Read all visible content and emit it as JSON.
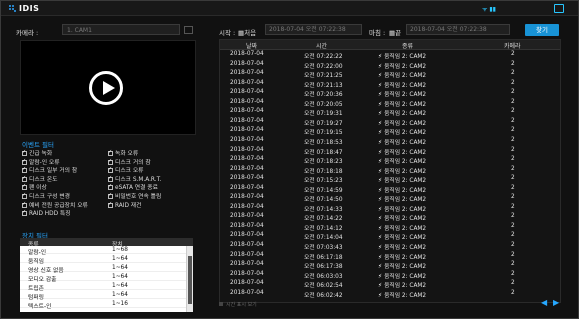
{
  "app": {
    "logo_text": "IDIS"
  },
  "camera": {
    "label": "카메라 :",
    "value": "1. CAM1"
  },
  "events": {
    "title": "이벤트 필터",
    "items": [
      "긴급 녹화",
      "녹화 오류",
      "알람-인 오류",
      "디스크 거의 참",
      "디스크 일부 거의 참",
      "디스크 오류",
      "디스크 온도",
      "디스크 S.M.A.R.T.",
      "팬 이상",
      "eSATA 연결 종료",
      "디스크 구성 변경",
      "비밀번호 연속 틀림",
      "예비 전원 공급장치 오류",
      "RAID 재건",
      "RAID HDD 특징"
    ]
  },
  "devices": {
    "title": "장치 필터",
    "columns": [
      "종류",
      "장치"
    ],
    "rows": [
      [
        "알람-인",
        "1~68"
      ],
      [
        "움직임",
        "1~64"
      ],
      [
        "영상 신호 없음",
        "1~64"
      ],
      [
        "모디오 감출",
        "1~64"
      ],
      [
        "트립존",
        "1~64"
      ],
      [
        "텀퍼링",
        "1~64"
      ],
      [
        "텍스트-인",
        "1~16"
      ]
    ]
  },
  "filter": {
    "start_label": "시작 :",
    "start_mode": "처음",
    "start_value": "2018-07-04 오전 07:22:38",
    "end_label": "마침 :",
    "end_mode": "끝",
    "end_value": "2018-07-04 오전 07:22:38",
    "search_label": "찾기"
  },
  "log": {
    "columns": [
      "날짜",
      "시간",
      "종류",
      "카메라"
    ],
    "rows": [
      [
        "2018-07-04",
        "오전 07:22:22",
        "움직임 2: CAM2",
        "2"
      ],
      [
        "2018-07-04",
        "오전 07:22:00",
        "움직임 2: CAM2",
        "2"
      ],
      [
        "2018-07-04",
        "오전 07:21:25",
        "움직임 2: CAM2",
        "2"
      ],
      [
        "2018-07-04",
        "오전 07:21:13",
        "움직임 2: CAM2",
        "2"
      ],
      [
        "2018-07-04",
        "오전 07:20:36",
        "움직임 2: CAM2",
        "2"
      ],
      [
        "2018-07-04",
        "오전 07:20:05",
        "움직임 2: CAM2",
        "2"
      ],
      [
        "2018-07-04",
        "오전 07:19:31",
        "움직임 2: CAM2",
        "2"
      ],
      [
        "2018-07-04",
        "오전 07:19:27",
        "움직임 2: CAM2",
        "2"
      ],
      [
        "2018-07-04",
        "오전 07:19:15",
        "움직임 2: CAM2",
        "2"
      ],
      [
        "2018-07-04",
        "오전 07:18:53",
        "움직임 2: CAM2",
        "2"
      ],
      [
        "2018-07-04",
        "오전 07:18:47",
        "움직임 2: CAM2",
        "2"
      ],
      [
        "2018-07-04",
        "오전 07:18:23",
        "움직임 2: CAM2",
        "2"
      ],
      [
        "2018-07-04",
        "오전 07:18:18",
        "움직임 2: CAM2",
        "2"
      ],
      [
        "2018-07-04",
        "오전 07:15:23",
        "움직임 2: CAM2",
        "2"
      ],
      [
        "2018-07-04",
        "오전 07:14:59",
        "움직임 2: CAM2",
        "2"
      ],
      [
        "2018-07-04",
        "오전 07:14:50",
        "움직임 2: CAM2",
        "2"
      ],
      [
        "2018-07-04",
        "오전 07:14:33",
        "움직임 2: CAM2",
        "2"
      ],
      [
        "2018-07-04",
        "오전 07:14:22",
        "움직임 2: CAM2",
        "2"
      ],
      [
        "2018-07-04",
        "오전 07:14:12",
        "움직임 2: CAM2",
        "2"
      ],
      [
        "2018-07-04",
        "오전 07:14:04",
        "움직임 2: CAM2",
        "2"
      ],
      [
        "2018-07-04",
        "오전 07:03:43",
        "움직임 2: CAM2",
        "2"
      ],
      [
        "2018-07-04",
        "오전 06:17:18",
        "움직임 2: CAM2",
        "2"
      ],
      [
        "2018-07-04",
        "오전 06:17:38",
        "움직임 2: CAM2",
        "2"
      ],
      [
        "2018-07-04",
        "오전 06:03:03",
        "움직임 2: CAM2",
        "2"
      ],
      [
        "2018-07-04",
        "오전 06:02:54",
        "움직임 2: CAM2",
        "2"
      ],
      [
        "2018-07-04",
        "오전 06:02:42",
        "움직임 2: CAM2",
        "2"
      ]
    ]
  },
  "footer": {
    "note": "시간 표시 보기"
  }
}
